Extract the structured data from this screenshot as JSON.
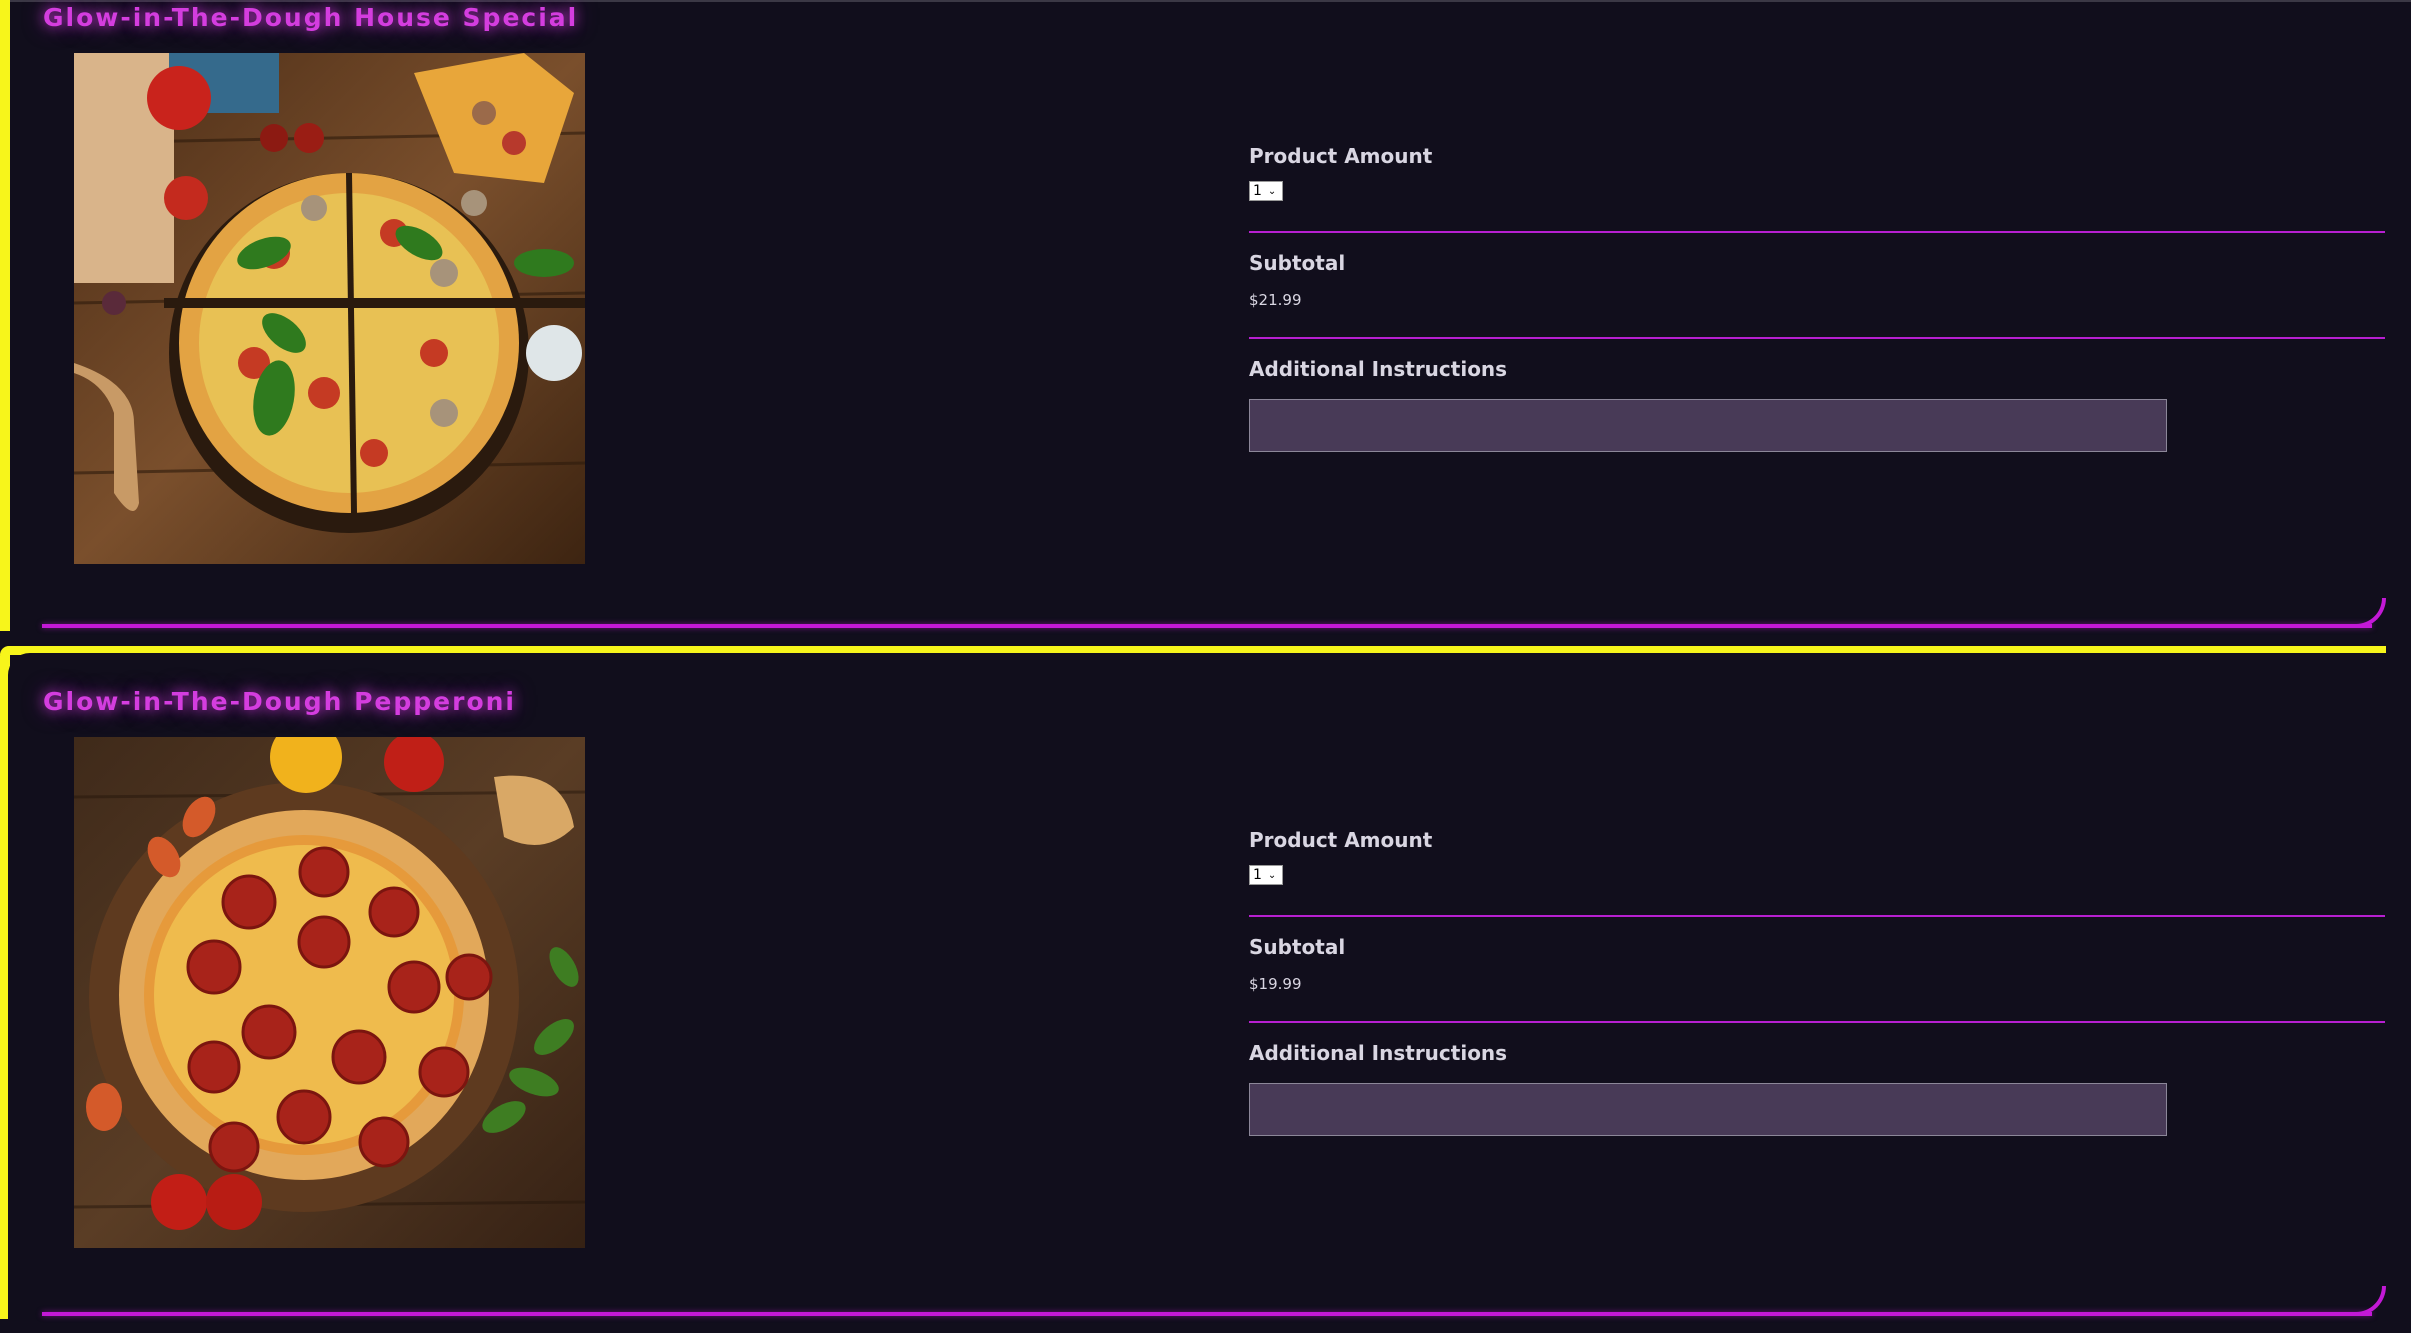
{
  "products": [
    {
      "name": "Glow-in-The-Dough House Special",
      "image_alt": "House special pizza",
      "amount_label": "Product Amount",
      "amount_value": "1",
      "subtotal_label": "Subtotal",
      "subtotal_value": "$21.99",
      "instructions_label": "Additional Instructions",
      "instructions_value": ""
    },
    {
      "name": "Glow-in-The-Dough Pepperoni",
      "image_alt": "Pepperoni pizza",
      "amount_label": "Product Amount",
      "amount_value": "1",
      "subtotal_label": "Subtotal",
      "subtotal_value": "$19.99",
      "instructions_label": "Additional Instructions",
      "instructions_value": ""
    }
  ],
  "colors": {
    "background": "#110e1c",
    "accent_yellow": "#f7f51b",
    "accent_magenta": "#c319d6",
    "title_glow": "#d43ddf",
    "input_fill": "#483a57"
  },
  "icons": [
    "chevron-down-icon"
  ]
}
